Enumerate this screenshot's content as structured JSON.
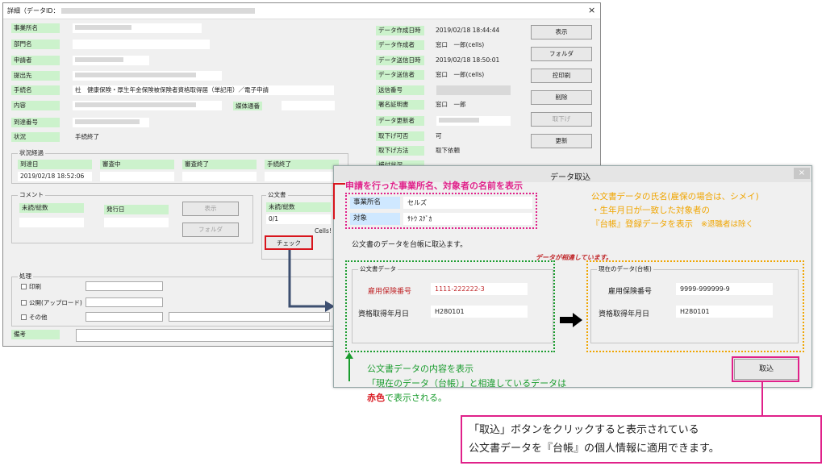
{
  "main": {
    "title_prefix": "詳細（データID：",
    "close": "×",
    "left_labels": {
      "business": "事業所名",
      "dept": "部門名",
      "applicant": "申請者",
      "submit_to": "提出先",
      "procedure": "手続名",
      "content": "内容",
      "arrival_no": "到達番号",
      "status": "状況"
    },
    "procedure_value": "社　健康保険・厚生年金保険被保険者資格取得届（単記用）／電子申請",
    "media_label": "媒体通番",
    "status_value": "手続終了",
    "right_labels": {
      "created_at": "データ作成日時",
      "creator": "データ作成者",
      "sent_at": "データ送信日時",
      "sender": "データ送信者",
      "send_no": "送信番号",
      "cert": "署名証明書",
      "updater": "データ更新者",
      "withdrawable": "取下げ可否",
      "withdraw_method": "取下げ方法",
      "extra": "補付状況"
    },
    "right_values": {
      "created_at": "2019/02/18 18:44:44",
      "creator": "窓口　一郎(cells)",
      "sent_at": "2019/02/18 18:50:01",
      "sender": "窓口　一郎(cells)",
      "cert": "窓口　一郎",
      "withdrawable": "可",
      "withdraw_method": "取下依頼"
    },
    "buttons": {
      "show": "表示",
      "folder": "フォルダ",
      "copy_print": "控印刷",
      "delete": "削除",
      "withdraw": "取下げ",
      "update": "更新"
    },
    "progress": {
      "title": "状況経過",
      "cols": [
        "到達日",
        "審査中",
        "審査終了",
        "手続終了"
      ],
      "arrival_value": "2019/02/18 18:52:06"
    },
    "comment": {
      "title": "コメント",
      "unread": "未読/総数",
      "issue_date": "発行日",
      "show": "表示",
      "folder": "フォルダ"
    },
    "official": {
      "title": "公文書",
      "unread": "未読/総数",
      "count": "0/1",
      "cells": "Cells!",
      "check": "チェック"
    },
    "process": {
      "title": "処理",
      "print": "印刷",
      "publish": "公開(アップロード)",
      "other": "その他"
    },
    "remarks": "備考"
  },
  "dialog": {
    "title": "データ取込",
    "close": "×",
    "business_label": "事業所名",
    "business_value": "セルズ",
    "target_label": "対象",
    "target_value": "ｻﾄｳ ｽｸﾞｶ",
    "instruction": "公文書のデータを台帳に取込ます。",
    "mismatch": "データが相違しています。",
    "official_group": "公文書データ",
    "current_group": "現在のデータ(台帳)",
    "insurance_label": "雇用保険番号",
    "acquired_label": "資格取得年月日",
    "official_insurance": "1111-222222-3",
    "official_acquired": "H280101",
    "current_insurance": "9999-999999-9",
    "current_acquired": "H280101",
    "import_button": "取込"
  },
  "annotations": {
    "top": "申請を行った事業所名、対象者の名前を表示",
    "orange_1": "公文書データの氏名(雇保の場合は、シメイ)",
    "orange_2": "・生年月日が一致した対象者の",
    "orange_3a": "『台帳』登録データを表示",
    "orange_3b": "※退職者は除く",
    "green_1": "公文書データの内容を表示",
    "green_2": "「現在のデータ（台帳）」と相違しているデータは",
    "red_word": "赤色",
    "green_3": "で表示される。",
    "pink_1": "「取込」ボタンをクリックすると表示されている",
    "pink_2": "公文書データを『台帳』の個人情報に適用できます。"
  },
  "colors": {
    "green_label": "#ccf2cc",
    "blue_label": "#cfe8ff",
    "red_text": "#c0282b",
    "pink": "#e0218a",
    "orange": "#f0a500",
    "green_ann": "#1a9c2e",
    "arrow": "#3d4f70"
  }
}
